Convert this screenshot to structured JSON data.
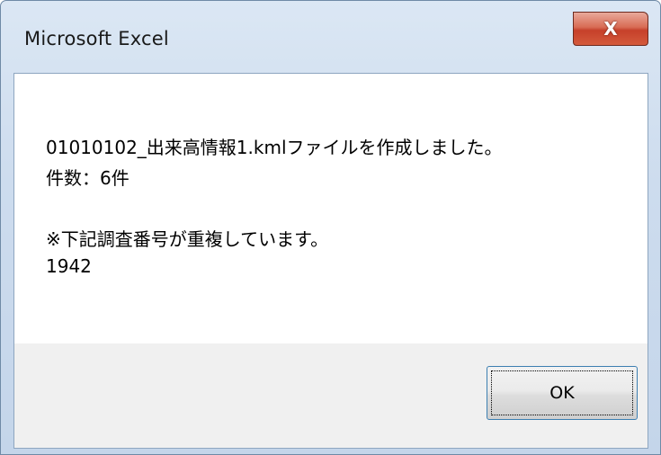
{
  "window": {
    "title": "Microsoft Excel",
    "close_glyph": "X",
    "close_icon": "close-icon"
  },
  "message": {
    "line1": "01010102_出来高情報1.kmlファイルを作成しました。",
    "line2": "件数：6件",
    "line3": "※下記調査番号が重複しています。",
    "line4": "1942"
  },
  "buttons": {
    "ok_label": "OK"
  },
  "colors": {
    "close_button": "#c6402a",
    "focus_border": "#3c7fb1"
  }
}
